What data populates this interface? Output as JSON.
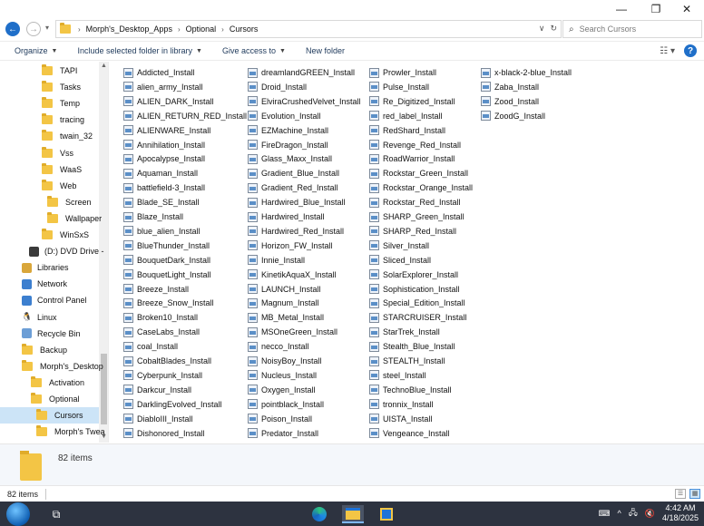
{
  "window": {
    "minimize_glyph": "—",
    "maximize_glyph": "❐",
    "close_glyph": "✕"
  },
  "address": {
    "crumbs": [
      "Morph's_Desktop_Apps",
      "Optional",
      "Cursors"
    ],
    "search_placeholder": "Search Cursors"
  },
  "commands": {
    "organize": "Organize",
    "include_library": "Include selected folder in library",
    "give_access": "Give access to",
    "new_folder": "New folder"
  },
  "sidebar": {
    "items": [
      {
        "label": "TAPI"
      },
      {
        "label": "Tasks"
      },
      {
        "label": "Temp"
      },
      {
        "label": "tracing"
      },
      {
        "label": "twain_32"
      },
      {
        "label": "Vss"
      },
      {
        "label": "WaaS"
      },
      {
        "label": "Web"
      },
      {
        "label": "Screen"
      },
      {
        "label": "Wallpaper"
      },
      {
        "label": "WinSxS"
      },
      {
        "label": "(D:) DVD Drive -"
      },
      {
        "label": "Libraries"
      },
      {
        "label": "Network"
      },
      {
        "label": "Control Panel"
      },
      {
        "label": "Linux"
      },
      {
        "label": "Recycle Bin"
      },
      {
        "label": "Backup"
      },
      {
        "label": "Morph's_Desktop"
      },
      {
        "label": "Activation"
      },
      {
        "label": "Optional"
      },
      {
        "label": "Cursors"
      },
      {
        "label": "Morph's Twea"
      }
    ]
  },
  "files": {
    "col1": [
      "Addicted_Install",
      "alien_army_Install",
      "ALIEN_DARK_Install",
      "ALIEN_RETURN_RED_Install",
      "ALIENWARE_Install",
      "Annihilation_Install",
      "Apocalypse_Install",
      "Aquaman_Install",
      "battlefield-3_Install",
      "Blade_SE_Install",
      "Blaze_Install",
      "blue_alien_Install",
      "BlueThunder_Install",
      "BouquetDark_Install",
      "BouquetLight_Install",
      "Breeze_Install",
      "Breeze_Snow_Install",
      "Broken10_Install",
      "CaseLabs_Install",
      "coal_Install",
      "CobaltBlades_Install",
      "Cyberpunk_Install",
      "Darkcur_Install",
      "DarklingEvolved_Install",
      "DiabloIII_Install",
      "Dishonored_Install"
    ],
    "col2": [
      "dreamlandGREEN_Install",
      "Droid_Install",
      "ElviraCrushedVelvet_Install",
      "Evolution_Install",
      "EZMachine_Install",
      "FireDragon_Install",
      "Glass_Maxx_Install",
      "Gradient_Blue_Install",
      "Gradient_Red_Install",
      "Hardwired_Blue_Install",
      "Hardwired_Install",
      "Hardwired_Red_Install",
      "Horizon_FW_Install",
      "Innie_Install",
      "KinetikAquaX_Install",
      "LAUNCH_Install",
      "Magnum_Install",
      "MB_Metal_Install",
      "MSOneGreen_Install",
      "necco_Install",
      "NoisyBoy_Install",
      "Nucleus_Install",
      "Oxygen_Install",
      "pointblack_Install",
      "Poison_Install",
      "Predator_Install"
    ],
    "col3": [
      "Prowler_Install",
      "Pulse_Install",
      "Re_Digitized_Install",
      "red_label_Install",
      "RedShard_Install",
      "Revenge_Red_Install",
      "RoadWarrior_Install",
      "Rockstar_Green_Install",
      "Rockstar_Orange_Install",
      "Rockstar_Red_Install",
      "SHARP_Green_Install",
      "SHARP_Red_Install",
      "Silver_Install",
      "Sliced_Install",
      "SolarExplorer_Install",
      "Sophistication_Install",
      "Special_Edition_Install",
      "STARCRUISER_Install",
      "StarTrek_Install",
      "Stealth_Blue_Install",
      "STEALTH_Install",
      "steel_Install",
      "TechnoBlue_Install",
      "tronnix_Install",
      "UISTA_Install",
      "Vengeance_Install"
    ],
    "col4": [
      "x-black-2-blue_Install",
      "Zaba_Install",
      "Zood_Install",
      "ZoodG_Install"
    ]
  },
  "details": {
    "count": "82 items"
  },
  "status": {
    "count": "82 items"
  },
  "taskbar": {
    "time": "4:42 AM",
    "date": "4/18/2025"
  },
  "colors": {
    "accent": "#1f6fc9",
    "selection": "#cce4f7",
    "folder": "#f3c545",
    "taskbar": "#2d3340"
  }
}
